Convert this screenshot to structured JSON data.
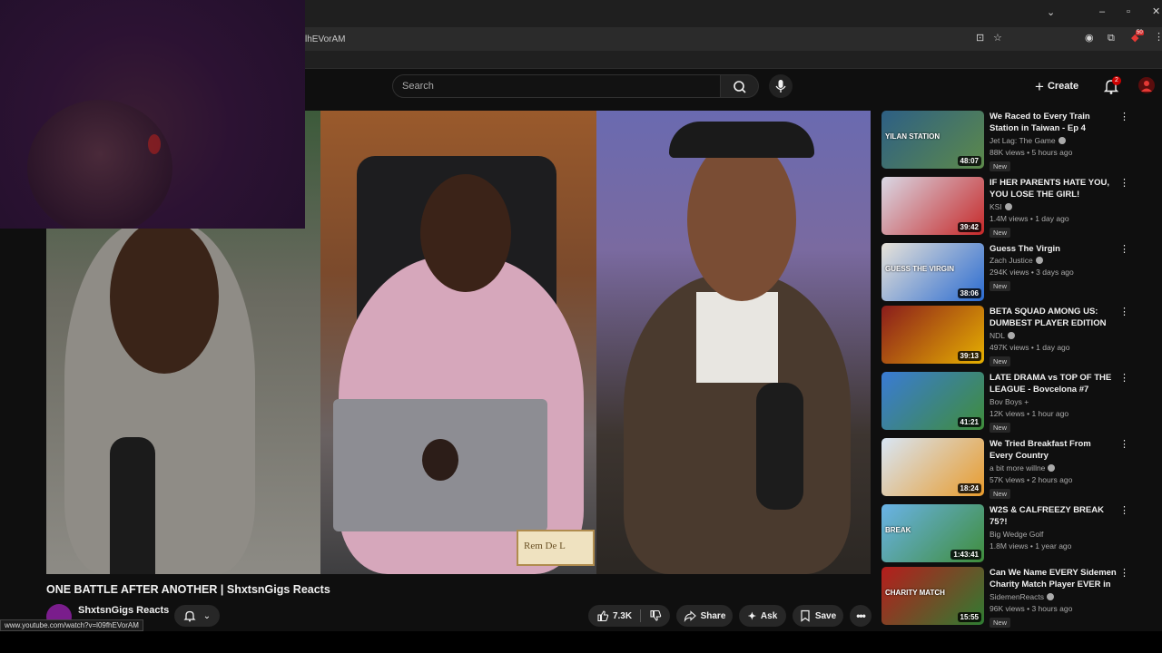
{
  "browser": {
    "url_fragment": "lhEVorAM",
    "status_url": "www.youtube.com/watch?v=l09fhEVorAM",
    "extension_badge": "50"
  },
  "header": {
    "search_placeholder": "Search",
    "create_label": "Create",
    "notification_count": "2"
  },
  "video": {
    "title": "ONE BATTLE AFTER ANOTHER | ShxtsnGigs Reacts",
    "channel": "ShxtsnGigs Reacts",
    "likes": "7.3K",
    "share_label": "Share",
    "ask_label": "Ask",
    "save_label": "Save",
    "nameplate": "Rem De L"
  },
  "recommendations": [
    {
      "title": "We Raced to Every Train Station in Taiwan - Ep 4",
      "channel": "Jet Lag: The Game",
      "verified": true,
      "meta": "88K views • 5 hours ago",
      "duration": "48:07",
      "badge": "New",
      "thumb_text": "YILAN STATION",
      "colors": [
        "#2d5f85",
        "#5d8a4a"
      ]
    },
    {
      "title": "IF HER PARENTS HATE YOU, YOU LOSE THE GIRL!",
      "channel": "KSI",
      "verified": true,
      "meta": "1.4M views • 1 day ago",
      "duration": "39:42",
      "badge": "New",
      "thumb_text": "",
      "colors": [
        "#d9d9e6",
        "#c62828"
      ]
    },
    {
      "title": "Guess The Virgin",
      "channel": "Zach Justice",
      "verified": true,
      "meta": "294K views • 3 days ago",
      "duration": "38:06",
      "badge": "New",
      "thumb_text": "GUESS THE VIRGIN",
      "colors": [
        "#e8e3d9",
        "#2a6bd1"
      ]
    },
    {
      "title": "BETA SQUAD AMONG US: DUMBEST PLAYER EDITION",
      "channel": "NDL",
      "verified": true,
      "meta": "497K views • 1 day ago",
      "duration": "39:13",
      "badge": "New",
      "thumb_text": "",
      "colors": [
        "#8a1c1c",
        "#e6b000"
      ]
    },
    {
      "title": "LATE DRAMA vs TOP OF THE LEAGUE - Bovcelona #7",
      "channel": "Bov Boys +",
      "verified": false,
      "meta": "12K views • 1 hour ago",
      "duration": "41:21",
      "badge": "New",
      "thumb_text": "",
      "colors": [
        "#3a7bd5",
        "#3f8d3a"
      ]
    },
    {
      "title": "We Tried Breakfast From Every Country",
      "channel": "a bit more willne",
      "verified": true,
      "meta": "57K views • 2 hours ago",
      "duration": "18:24",
      "badge": "New",
      "thumb_text": "",
      "colors": [
        "#d8e6f5",
        "#e89b2c"
      ]
    },
    {
      "title": "W2S & CALFREEZY BREAK 75?!",
      "channel": "Big Wedge Golf",
      "verified": false,
      "meta": "1.8M views • 1 year ago",
      "duration": "1:43:41",
      "badge": "",
      "thumb_text": "BREAK",
      "colors": [
        "#6ab3e8",
        "#3f8d3a"
      ]
    },
    {
      "title": "Can We Name EVERY Sidemen Charity Match Player EVER in ...",
      "channel": "SidemenReacts",
      "verified": true,
      "meta": "96K views • 3 hours ago",
      "duration": "15:55",
      "badge": "New",
      "thumb_text": "CHARITY MATCH",
      "colors": [
        "#b71c1c",
        "#2e7d32"
      ]
    }
  ]
}
